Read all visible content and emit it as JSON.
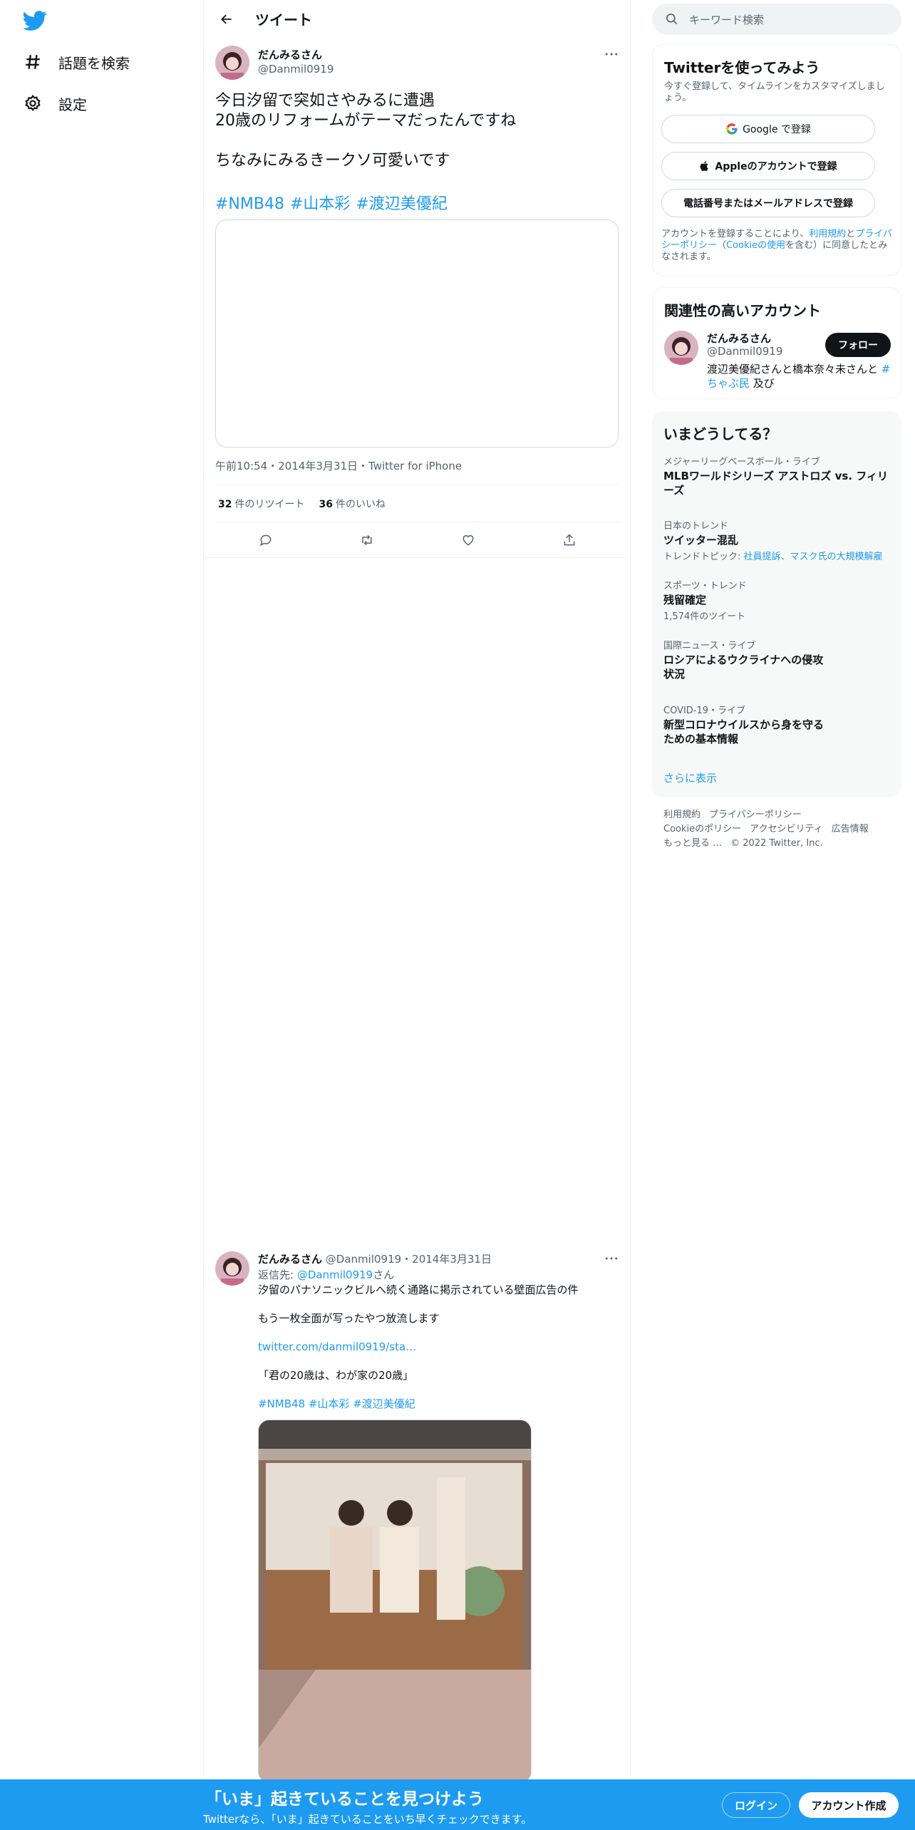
{
  "nav": {
    "explore_label": "話題を検索",
    "settings_label": "設定"
  },
  "header": {
    "title": "ツイート"
  },
  "tweet": {
    "display_name": "だんみるさん",
    "handle": "@Danmil0919",
    "text": "今日汐留で突如さやみるに遭遇\n20歳のリフォームがテーマだったんですね\n\nちなみにみるきークソ可愛いです",
    "hashtags": [
      "#NMB48",
      "#山本彩",
      "#渡辺美優紀"
    ],
    "meta": "午前10:54・2014年3月31日・Twitter for iPhone",
    "retweet_count": "32",
    "retweet_label": "件のリツイート",
    "like_count": "36",
    "like_label": "件のいいね"
  },
  "reply_tweet": {
    "display_name": "だんみるさん",
    "handle_date": "@Danmil0919・2014年3月31日",
    "reply_prefix": "返信先: ",
    "reply_to": "@Danmil0919",
    "reply_suffix": "さん",
    "line1": "汐留のパナソニックビルへ続く通路に掲示されている壁面広告の件",
    "line2": "もう一枚全面が写ったやつ放流します",
    "link": "twitter.com/danmil0919/sta…",
    "line3": "「君の20歳は、わが家の20歳」",
    "hashtags": "#NMB48 #山本彩 #渡辺美優紀"
  },
  "search": {
    "placeholder": "キーワード検索"
  },
  "signup_card": {
    "title": "Twitterを使ってみよう",
    "subtitle": "今すぐ登録して、タイムラインをカスタマイズしましょう。",
    "google_button": "Google で登録",
    "apple_button": "Appleのアカウントで登録",
    "phone_button": "電話番号またはメールアドレスで登録",
    "legal_prefix": "アカウントを登録することにより、",
    "legal_terms": "利用規約",
    "legal_and": "と",
    "legal_privacy": "プライバシーポリシー",
    "legal_open": "（",
    "legal_cookie": "Cookieの使用",
    "legal_suffix": "を含む）に同意したとみなされます。"
  },
  "related_card": {
    "title": "関連性の高いアカウント",
    "name": "だんみるさん",
    "handle": "@Danmil0919",
    "follow_button": "フォロー",
    "bio_text": "渡辺美優紀さんと橋本奈々未さんと",
    "bio_tag1": "#",
    "bio_tag2": "ちゃぶ民",
    "bio_end": " 及び"
  },
  "trends": {
    "title": "いまどうしてる？",
    "items": [
      {
        "category": "メジャーリーグベースボール・ライブ",
        "name": "MLBワールドシリーズ アストロズ vs. フィリーズ",
        "sub": ""
      },
      {
        "category": "日本のトレンド",
        "name": "ツイッター混乱",
        "sub_prefix": "トレンドトピック: ",
        "sub_link": "社員提訴、マスク氏の大規模解雇"
      },
      {
        "category": "スポーツ・トレンド",
        "name": "残留確定",
        "sub": "1,574件のツイート"
      },
      {
        "category": "国際ニュース・ライブ",
        "name": "ロシアによるウクライナへの侵攻状況",
        "sub": ""
      },
      {
        "category": "COVID-19・ライブ",
        "name": "新型コロナウイルスから身を守るための基本情報",
        "sub": ""
      }
    ],
    "show_more": "さらに表示"
  },
  "footer": {
    "links_row1": [
      "利用規約",
      "プライバシーポリシー"
    ],
    "links_row2": [
      "Cookieのポリシー",
      "アクセシビリティ",
      "広告情報"
    ],
    "more": "もっと見る …",
    "copyright": "© 2022 Twitter, Inc."
  },
  "banner": {
    "headline": "「いま」起きていることを見つけよう",
    "subtext": "Twitterなら、「いま」起きていることをいち早くチェックできます。",
    "login_button": "ログイン",
    "signup_button": "アカウント作成"
  },
  "colors": {
    "accent": "#1d9bf0",
    "text": "#0f1419",
    "secondary": "#536471"
  }
}
